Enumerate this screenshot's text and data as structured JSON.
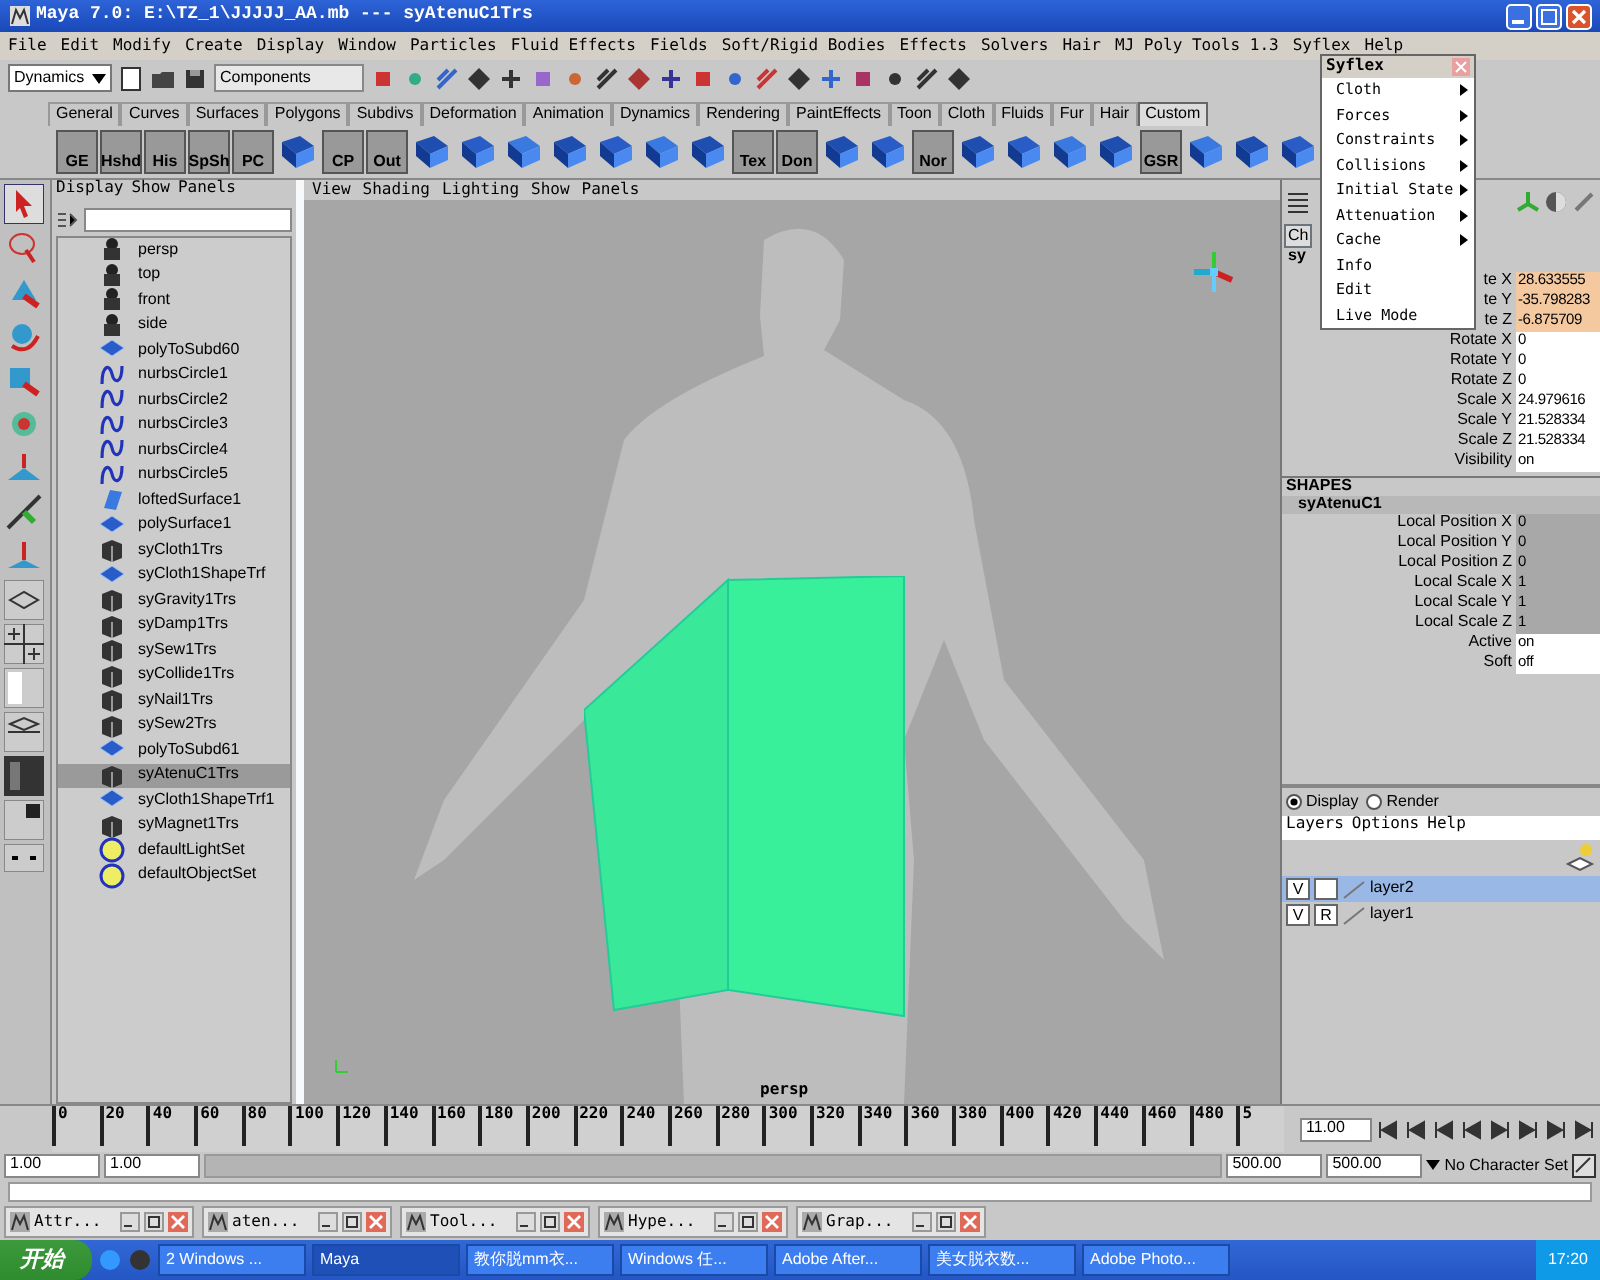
{
  "window": {
    "title": "Maya 7.0: E:\\TZ_1\\JJJJJ_AA.mb  ---  syAtenuC1Trs"
  },
  "menu_bar": [
    "File",
    "Edit",
    "Modify",
    "Create",
    "Display",
    "Window",
    "Particles",
    "Fluid Effects",
    "Fields",
    "Soft/Rigid Bodies",
    "Effects",
    "Solvers",
    "Hair",
    "MJ Poly Tools 1.3",
    "Syflex",
    "Help"
  ],
  "status_line": {
    "menu_set": "Dynamics",
    "selection_mode": "Components"
  },
  "shelf": {
    "tabs": [
      {
        "label": "General",
        "selected": false
      },
      {
        "label": "Curves",
        "selected": false
      },
      {
        "label": "Surfaces",
        "selected": false
      },
      {
        "label": "Polygons",
        "selected": false
      },
      {
        "label": "Subdivs",
        "selected": false
      },
      {
        "label": "Deformation",
        "selected": false
      },
      {
        "label": "Animation",
        "selected": false
      },
      {
        "label": "Dynamics",
        "selected": false
      },
      {
        "label": "Rendering",
        "selected": false
      },
      {
        "label": "PaintEffects",
        "selected": false
      },
      {
        "label": "Toon",
        "selected": false
      },
      {
        "label": "Cloth",
        "selected": false
      },
      {
        "label": "Fluids",
        "selected": false
      },
      {
        "label": "Fur",
        "selected": false
      },
      {
        "label": "Hair",
        "selected": false
      },
      {
        "label": "Custom",
        "selected": true
      }
    ],
    "items": [
      {
        "kind": "text",
        "label": "GE"
      },
      {
        "kind": "text",
        "label": "Hshd"
      },
      {
        "kind": "text",
        "label": "His"
      },
      {
        "kind": "text",
        "label": "SpSh"
      },
      {
        "kind": "text",
        "label": "PC"
      },
      {
        "kind": "icon"
      },
      {
        "kind": "text",
        "label": "CP"
      },
      {
        "kind": "text",
        "label": "Out"
      },
      {
        "kind": "icon"
      },
      {
        "kind": "icon"
      },
      {
        "kind": "icon"
      },
      {
        "kind": "icon"
      },
      {
        "kind": "icon"
      },
      {
        "kind": "icon"
      },
      {
        "kind": "icon"
      },
      {
        "kind": "text",
        "label": "Tex"
      },
      {
        "kind": "text",
        "label": "Don"
      },
      {
        "kind": "icon"
      },
      {
        "kind": "icon"
      },
      {
        "kind": "text",
        "label": "Nor"
      },
      {
        "kind": "icon"
      },
      {
        "kind": "icon"
      },
      {
        "kind": "icon"
      },
      {
        "kind": "icon"
      },
      {
        "kind": "text",
        "label": "GSR"
      },
      {
        "kind": "icon"
      },
      {
        "kind": "icon"
      },
      {
        "kind": "icon"
      }
    ]
  },
  "outliner": {
    "menu": [
      "Display",
      "Show",
      "Panels"
    ],
    "items": [
      {
        "label": "persp",
        "kind": "camera",
        "selected": false
      },
      {
        "label": "top",
        "kind": "camera",
        "selected": false
      },
      {
        "label": "front",
        "kind": "camera",
        "selected": false
      },
      {
        "label": "side",
        "kind": "camera",
        "selected": false
      },
      {
        "label": "polyToSubd60",
        "kind": "mesh",
        "selected": false
      },
      {
        "label": "nurbsCircle1",
        "kind": "curve",
        "selected": false
      },
      {
        "label": "nurbsCircle2",
        "kind": "curve",
        "selected": false
      },
      {
        "label": "nurbsCircle3",
        "kind": "curve",
        "selected": false
      },
      {
        "label": "nurbsCircle4",
        "kind": "curve",
        "selected": false
      },
      {
        "label": "nurbsCircle5",
        "kind": "curve",
        "selected": false
      },
      {
        "label": "loftedSurface1",
        "kind": "surface",
        "selected": false
      },
      {
        "label": "polySurface1",
        "kind": "mesh",
        "selected": false
      },
      {
        "label": "syCloth1Trs",
        "kind": "node",
        "selected": false
      },
      {
        "label": "syCloth1ShapeTrf",
        "kind": "mesh",
        "selected": false
      },
      {
        "label": "syGravity1Trs",
        "kind": "node",
        "selected": false
      },
      {
        "label": "syDamp1Trs",
        "kind": "node",
        "selected": false
      },
      {
        "label": "sySew1Trs",
        "kind": "node",
        "selected": false
      },
      {
        "label": "syCollide1Trs",
        "kind": "node",
        "selected": false
      },
      {
        "label": "syNail1Trs",
        "kind": "node",
        "selected": false
      },
      {
        "label": "sySew2Trs",
        "kind": "node",
        "selected": false
      },
      {
        "label": "polyToSubd61",
        "kind": "mesh",
        "selected": false
      },
      {
        "label": "syAtenuC1Trs",
        "kind": "node",
        "selected": true
      },
      {
        "label": "syCloth1ShapeTrf1",
        "kind": "mesh",
        "selected": false
      },
      {
        "label": "syMagnet1Trs",
        "kind": "node",
        "selected": false
      },
      {
        "label": "defaultLightSet",
        "kind": "set",
        "selected": false
      },
      {
        "label": "defaultObjectSet",
        "kind": "set",
        "selected": false
      }
    ]
  },
  "viewport": {
    "menu": [
      "View",
      "Shading",
      "Lighting",
      "Show",
      "Panels"
    ],
    "camera_label": "persp"
  },
  "syflex_menu": {
    "title": "Syflex",
    "items": [
      {
        "label": "Cloth",
        "submenu": true
      },
      {
        "label": "Forces",
        "submenu": true
      },
      {
        "label": "Constraints",
        "submenu": true
      },
      {
        "label": "Collisions",
        "submenu": true
      },
      {
        "label": "Initial State",
        "submenu": true
      },
      {
        "label": "Attenuation",
        "submenu": true
      },
      {
        "label": "Cache",
        "submenu": true
      },
      {
        "label": "Info",
        "submenu": false
      },
      {
        "label": "Edit",
        "submenu": false
      },
      {
        "label": "Live Mode",
        "submenu": false
      }
    ]
  },
  "channel_box": {
    "tab": "Ch",
    "object": "sy",
    "attributes": [
      {
        "label": "te X",
        "value": "28.633555",
        "keyed": true
      },
      {
        "label": "te Y",
        "value": "-35.798283",
        "keyed": true
      },
      {
        "label": "te Z",
        "value": "-6.875709",
        "keyed": true
      },
      {
        "label": "Rotate X",
        "value": "0",
        "keyed": false
      },
      {
        "label": "Rotate Y",
        "value": "0",
        "keyed": false
      },
      {
        "label": "Rotate Z",
        "value": "0",
        "keyed": false
      },
      {
        "label": "Scale X",
        "value": "24.979616",
        "keyed": false
      },
      {
        "label": "Scale Y",
        "value": "21.528334",
        "keyed": false
      },
      {
        "label": "Scale Z",
        "value": "21.528334",
        "keyed": false
      },
      {
        "label": "Visibility",
        "value": "on",
        "keyed": false
      }
    ],
    "shapes_header": "SHAPES",
    "shape_name": "syAtenuC1",
    "shape_attributes": [
      {
        "label": "Local Position X",
        "value": "0",
        "locked": true
      },
      {
        "label": "Local Position Y",
        "value": "0",
        "locked": true
      },
      {
        "label": "Local Position Z",
        "value": "0",
        "locked": true
      },
      {
        "label": "Local Scale X",
        "value": "1",
        "locked": true
      },
      {
        "label": "Local Scale Y",
        "value": "1",
        "locked": true
      },
      {
        "label": "Local Scale Z",
        "value": "1",
        "locked": true
      },
      {
        "label": "Active",
        "value": "on",
        "locked": false
      },
      {
        "label": "Soft",
        "value": "off",
        "locked": false
      }
    ]
  },
  "layer_editor": {
    "modes": [
      {
        "label": "Display",
        "selected": true
      },
      {
        "label": "Render",
        "selected": false
      }
    ],
    "menu": [
      "Layers",
      "Options",
      "Help"
    ],
    "layers": [
      {
        "name": "layer2",
        "visibility": "V",
        "selected": true
      },
      {
        "name": "layer1",
        "visibility": "V",
        "display_type": "R",
        "selected": false
      }
    ]
  },
  "time_slider": {
    "ticks": [
      "0",
      "20",
      "40",
      "60",
      "80",
      "100",
      "120",
      "140",
      "160",
      "180",
      "200",
      "220",
      "240",
      "260",
      "280",
      "300",
      "320",
      "340",
      "360",
      "380",
      "400",
      "420",
      "440",
      "460",
      "480",
      "5"
    ],
    "current_time": "11.00"
  },
  "range_slider": {
    "level": 1,
    "start": "1.00",
    "playback_start": "1.00",
    "playback_end": "500.00",
    "end": "500.00",
    "character_set": "No Character Set"
  },
  "minimized_windows": [
    "Attr...",
    "aten...",
    "Tool...",
    "Hype...",
    "Grap..."
  ],
  "taskbar": {
    "start": "开始",
    "tasks": [
      {
        "label": "2 Windows ...",
        "selected": false
      },
      {
        "label": "Maya",
        "selected": true
      },
      {
        "label": "教你脱mm衣...",
        "selected": false
      },
      {
        "label": "Windows 任...",
        "selected": false
      },
      {
        "label": "Adobe After...",
        "selected": false
      },
      {
        "label": "美女脱衣数...",
        "selected": false
      },
      {
        "label": "Adobe Photo...",
        "selected": false
      }
    ],
    "clock": "17:20"
  }
}
